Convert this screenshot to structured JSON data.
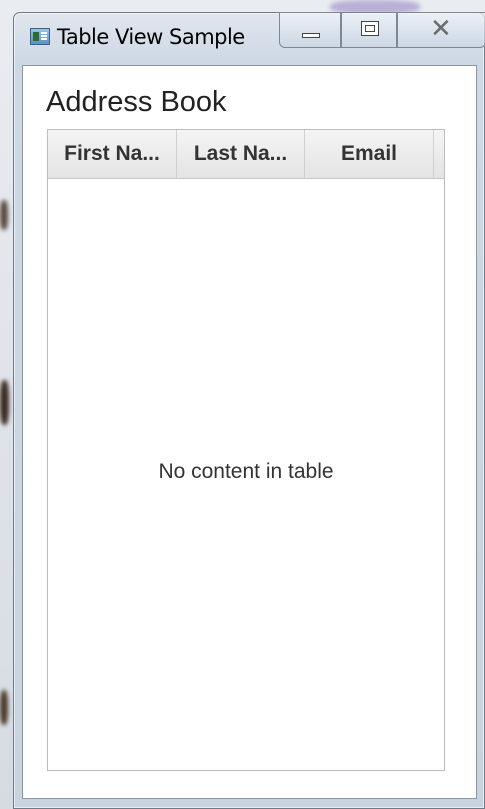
{
  "window": {
    "title": "Table View Sample",
    "close_symbol": "✕"
  },
  "page": {
    "heading": "Address Book"
  },
  "table": {
    "columns": [
      "First Na...",
      "Last Na...",
      "Email"
    ],
    "placeholder": "No content in table"
  },
  "icons": {
    "app": "app-window-icon",
    "minimize": "minimize-icon",
    "maximize": "maximize-icon",
    "close": "close-icon"
  }
}
